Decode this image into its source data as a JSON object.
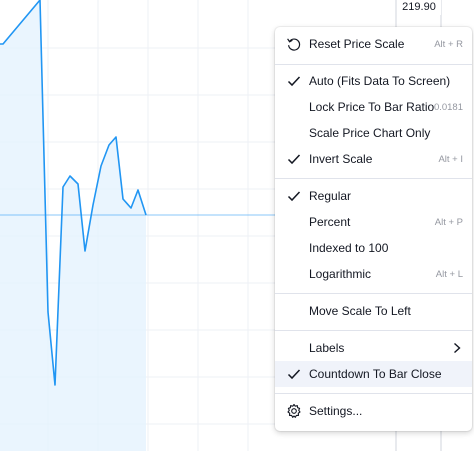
{
  "chart": {
    "top_price_label": "219.90",
    "line_color": "#2196f3",
    "area_color": "#e3f2fd",
    "grid_color": "#eef1f6"
  },
  "menu": {
    "reset_price_scale": {
      "label": "Reset Price Scale",
      "hotkey": "Alt + R"
    },
    "auto_fit": {
      "label": "Auto (Fits Data To Screen)",
      "checked": true
    },
    "lock_ratio": {
      "label": "Lock Price To Bar Ratio",
      "value": "0.0181"
    },
    "scale_price_chart_only": {
      "label": "Scale Price Chart Only"
    },
    "invert_scale": {
      "label": "Invert Scale",
      "hotkey": "Alt + I",
      "checked": true
    },
    "regular": {
      "label": "Regular",
      "checked": true
    },
    "percent": {
      "label": "Percent",
      "hotkey": "Alt + P"
    },
    "indexed_to_100": {
      "label": "Indexed to 100"
    },
    "logarithmic": {
      "label": "Logarithmic",
      "hotkey": "Alt + L"
    },
    "move_scale_left": {
      "label": "Move Scale To Left"
    },
    "labels": {
      "label": "Labels"
    },
    "countdown": {
      "label": "Countdown To Bar Close",
      "checked": true
    },
    "settings": {
      "label": "Settings..."
    }
  }
}
